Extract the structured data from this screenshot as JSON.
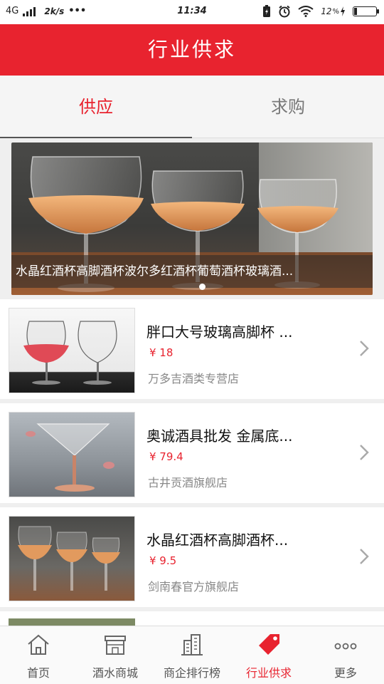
{
  "status_bar": {
    "network": "4G",
    "speed": "2k/s",
    "time": "11:34",
    "battery": "12",
    "battery_level": 0.12
  },
  "app_bar": {
    "title": "行业供求"
  },
  "tabs": [
    {
      "label": "供应",
      "active": true
    },
    {
      "label": "求购",
      "active": false
    }
  ],
  "banner": {
    "caption": "水晶红酒杯高脚酒杯波尔多红酒杯葡萄酒杯玻璃酒...",
    "page_count": 1,
    "current_page": 1
  },
  "products": [
    {
      "name": "胖口大号玻璃高脚杯 ...",
      "price": "¥ 18",
      "shop": "万多吉酒类专营店"
    },
    {
      "name": "奥诚酒具批发 金属底...",
      "price": "¥ 79.4",
      "shop": "古井贡酒旗舰店"
    },
    {
      "name": "水晶红酒杯高脚酒杯...",
      "price": "¥ 9.5",
      "shop": "剑南春官方旗舰店"
    }
  ],
  "bottom_nav": [
    {
      "label": "首页",
      "icon": "home-icon",
      "active": false
    },
    {
      "label": "酒水商城",
      "icon": "store-icon",
      "active": false
    },
    {
      "label": "商企排行榜",
      "icon": "buildings-icon",
      "active": false
    },
    {
      "label": "行业供求",
      "icon": "tag-icon",
      "active": true
    },
    {
      "label": "更多",
      "icon": "more-icon",
      "active": false
    }
  ],
  "colors": {
    "brand_red": "#e8232f",
    "text_gray": "#888888"
  }
}
